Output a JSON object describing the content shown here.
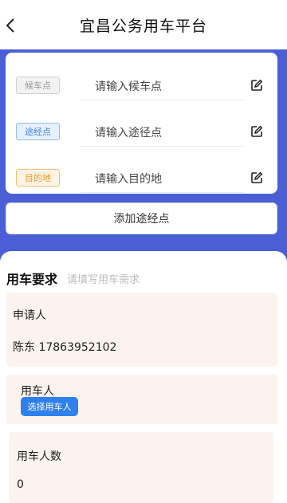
{
  "header": {
    "title": "宜昌公务用车平台",
    "back_icon": "chevron-left-icon"
  },
  "route": {
    "stops": [
      {
        "tag": "候车点",
        "placeholder": "请输入候车点",
        "tag_color": "#999999"
      },
      {
        "tag": "途经点",
        "placeholder": "请输入途径点",
        "tag_color": "#3f86e0"
      },
      {
        "tag": "目的地",
        "placeholder": "请输入目的地",
        "tag_color": "#e99b35"
      }
    ],
    "edit_icon": "edit-icon",
    "add_waypoint_label": "添加途经点"
  },
  "requirements": {
    "title": "用车要求",
    "hint": "请填写用车需求",
    "applicant_label": "申请人",
    "applicant_value": "陈东 17863952102",
    "user_label": "用车人",
    "choose_user_label": "选择用车人",
    "passenger_count_label": "用车人数",
    "passenger_count_value": "0"
  },
  "colors": {
    "accent_blue": "#4a5fd6",
    "button_blue": "#2f80ed",
    "field_bg": "#fdf3ee"
  }
}
